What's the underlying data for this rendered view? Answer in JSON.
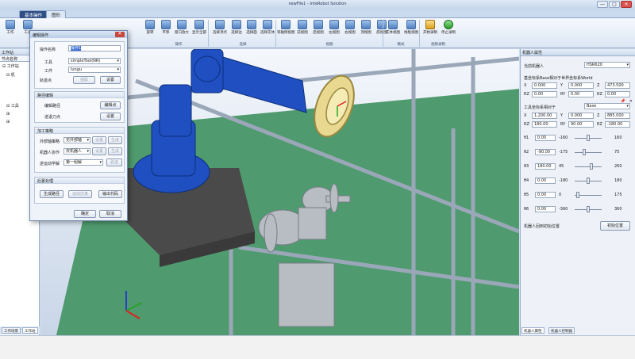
{
  "window": {
    "title": "newFile1 - InteRobot Solution",
    "min": "—",
    "max": "□",
    "close": "✕"
  },
  "tabs": [
    {
      "label": "基本操作"
    },
    {
      "label": "图形"
    },
    {
      "label": "机器人离线编程"
    }
  ],
  "ribbon": {
    "buttons": [
      "旋转",
      "平移",
      "窗口放大",
      "显示全部",
      "选择顶点",
      "选择边",
      "选择面",
      "选择实体",
      "等轴侧视图",
      "前视图",
      "后视图",
      "左视图",
      "右视图",
      "顶视图",
      "底视图",
      "实体视图",
      "线框视图",
      "开始录制",
      "停止录制"
    ],
    "groups": [
      "操作",
      "选择",
      "视图",
      "模式",
      "视频录制"
    ],
    "left_partial": [
      "工作",
      "工具"
    ]
  },
  "left_panel": {
    "title": "工作站",
    "header": "节点名称",
    "tree": [
      "工作站",
      "机",
      "工具",
      "",
      ""
    ],
    "tabs": [
      "工作场景",
      "工作站"
    ]
  },
  "dialog": {
    "title": "编辑操作",
    "close": "✕",
    "op_name_label": "操作名称",
    "op_name_value": "操作1",
    "tool_label": "工具",
    "tool_value": "simpleTool(NR)",
    "work_label": "工件",
    "work_value": "lungu",
    "trail_label": "轨迹点",
    "trail_btn": "拾取",
    "set_btn": "设置",
    "sec1": "路径编辑",
    "edit_path": "编辑路径",
    "edit_points_btn": "编辑点",
    "approach": "进退刀点",
    "approach_btn": "设置",
    "sec2": "加工策略",
    "ext_axis_label": "外部轴策略",
    "ext_axis_value": "无外部轴",
    "ext_set": "设置",
    "ext_gen": "生成",
    "robot_motion_label": "机器人协作",
    "robot_motion_value": "仅机器人",
    "rm_set": "设置",
    "rm_gen": "生成",
    "ik_label": "逆运动学解",
    "ik_value": "第一组解",
    "ik_btn": "验证",
    "sec3": "后置处理",
    "gen_path": "生成路径",
    "sim": "运动仿真",
    "out_code": "输出代码",
    "ok": "确定",
    "cancel": "取消"
  },
  "right_panel": {
    "title": "机器人属性",
    "pin": "📌",
    "close": "✕",
    "robot_label": "当前机器人",
    "robot_value": "HSR620",
    "base_frame_label": "基坐标系Base相对于世界坐标系World",
    "tool_frame_label": "工具坐标系相对于",
    "tool_frame_value": "Base",
    "base_xyz": [
      {
        "k": "X",
        "v": "0.000"
      },
      {
        "k": "Y",
        "v": "0.000"
      },
      {
        "k": "Z",
        "v": "473.500"
      }
    ],
    "base_rpy": [
      {
        "k": "RZ",
        "v": "0.00"
      },
      {
        "k": "RY",
        "v": "0.00"
      },
      {
        "k": "RZ",
        "v": "0.00"
      }
    ],
    "tool_xyz": [
      {
        "k": "X",
        "v": "1,200.00"
      },
      {
        "k": "Y",
        "v": "0.000"
      },
      {
        "k": "Z",
        "v": "885.000"
      }
    ],
    "tool_rpy": [
      {
        "k": "RZ",
        "v": "180.00"
      },
      {
        "k": "RY",
        "v": "90.00"
      },
      {
        "k": "RZ",
        "v": "-180.00"
      }
    ],
    "joints": [
      {
        "name": "θ1",
        "value": "0.00",
        "min": "-160",
        "max": "160",
        "pos": 0.5
      },
      {
        "name": "θ2",
        "value": "-90.00",
        "min": "-175",
        "max": "75",
        "pos": 0.34
      },
      {
        "name": "θ3",
        "value": "180.00",
        "min": "45",
        "max": "260",
        "pos": 0.63
      },
      {
        "name": "θ4",
        "value": "0.00",
        "min": "-180",
        "max": "180",
        "pos": 0.5
      },
      {
        "name": "θ5",
        "value": "0.00",
        "min": "0",
        "max": "175",
        "pos": 0.08
      },
      {
        "name": "θ6",
        "value": "0.00",
        "min": "-360",
        "max": "360",
        "pos": 0.5
      }
    ],
    "home_label": "机器人回到初始位置",
    "home_btn": "初始位置",
    "tabs": [
      "机器人属性",
      "机器人控制器"
    ]
  },
  "colors": {
    "accent": "#2f4f86",
    "robot": "#1f4fc0",
    "floor": "#4f9a6e",
    "part": "#e8d890"
  }
}
